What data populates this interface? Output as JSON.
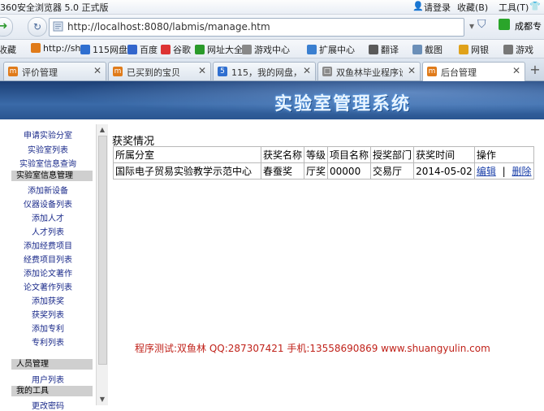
{
  "browser": {
    "title": "360安全浏览器 5.0 正式版",
    "login": "请登录",
    "menu": [
      "收藏(B)",
      "工具(T)"
    ],
    "url": "http://localhost:8080/labmis/manage.htm",
    "user_label": "成都专",
    "bookmarks": [
      "收藏",
      "http://sh",
      "115网盘",
      "百度",
      "谷歌",
      "网址大全",
      "游戏中心",
      "扩展中心",
      "翻译",
      "截图",
      "网银",
      "游戏"
    ],
    "tabs": [
      {
        "label": "评价管理"
      },
      {
        "label": "已买到的宝贝"
      },
      {
        "label": "115，我的网盘，..."
      },
      {
        "label": "双鱼林毕业程序设..."
      },
      {
        "label": "后台管理"
      }
    ],
    "active_tab": 4
  },
  "banner": {
    "title": "实验室管理系统"
  },
  "sidebar": {
    "group1": [
      "申请实验分室",
      "实验室列表",
      "实验室信息查询"
    ],
    "group2_header": "实验室信息管理",
    "group2": [
      "添加新设备",
      "仪器设备列表",
      "添加人才",
      "人才列表",
      "添加经费项目",
      "经费项目列表",
      "添加论文著作",
      "论文著作列表",
      "添加获奖",
      "获奖列表",
      "添加专利",
      "专利列表"
    ],
    "group3_header": "人员管理",
    "group3": [
      "用户列表"
    ],
    "group4_header": "我的工具",
    "group4": [
      "更改密码"
    ]
  },
  "main": {
    "section_title": "获奖情况",
    "columns": [
      "所属分室",
      "获奖名称",
      "等级",
      "项目名称",
      "授奖部门",
      "获奖时间",
      "操作"
    ],
    "rows": [
      {
        "cells": [
          "国际电子贸易实验教学示范中心",
          "春蚕奖",
          "厅奖",
          "00000",
          "交易厅",
          "2014-05-02"
        ],
        "edit": "编辑",
        "sep": "|",
        "delete": "删除"
      }
    ],
    "footer": "程序测试:双鱼林 QQ:287307421 手机:13558690869 www.shuangyulin.com"
  },
  "colors": {
    "banner": "#2a5590",
    "link": "#1a2a8a",
    "footer": "#c0221a",
    "header_bg": "#cfcfcf"
  }
}
